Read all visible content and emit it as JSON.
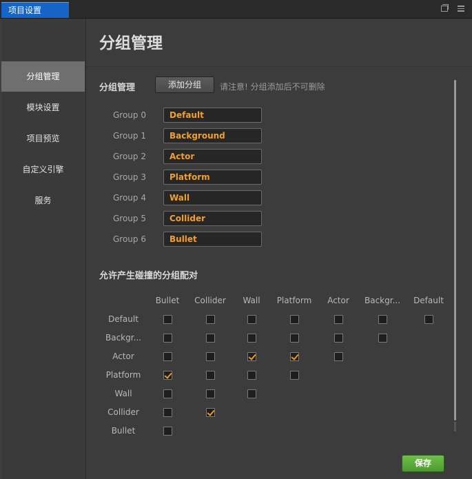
{
  "window": {
    "tab_title": "项目设置"
  },
  "sidebar": {
    "items": [
      {
        "label": "分组管理"
      },
      {
        "label": "模块设置"
      },
      {
        "label": "项目预览"
      },
      {
        "label": "自定义引擎"
      },
      {
        "label": "服务"
      }
    ],
    "active_index": 0
  },
  "main": {
    "title": "分组管理",
    "group_section_label": "分组管理",
    "add_group_button": "添加分组",
    "hint": "请注意! 分组添加后不可删除",
    "groups": [
      {
        "label": "Group 0",
        "name": "Default"
      },
      {
        "label": "Group 1",
        "name": "Background"
      },
      {
        "label": "Group 2",
        "name": "Actor"
      },
      {
        "label": "Group 3",
        "name": "Platform"
      },
      {
        "label": "Group 4",
        "name": "Wall"
      },
      {
        "label": "Group 5",
        "name": "Collider"
      },
      {
        "label": "Group 6",
        "name": "Bullet"
      }
    ],
    "collision_section_label": "允许产生碰撞的分组配对",
    "matrix_columns": [
      "Bullet",
      "Collider",
      "Wall",
      "Platform",
      "Actor",
      "Backgr...",
      "Default"
    ],
    "matrix_rows": [
      {
        "label": "Default",
        "checks": [
          false,
          false,
          false,
          false,
          false,
          false,
          false
        ]
      },
      {
        "label": "Backgr...",
        "checks": [
          false,
          false,
          false,
          false,
          false,
          false
        ]
      },
      {
        "label": "Actor",
        "checks": [
          false,
          false,
          true,
          true,
          false
        ]
      },
      {
        "label": "Platform",
        "checks": [
          true,
          false,
          false,
          false
        ]
      },
      {
        "label": "Wall",
        "checks": [
          false,
          false,
          false
        ]
      },
      {
        "label": "Collider",
        "checks": [
          false,
          true
        ]
      },
      {
        "label": "Bullet",
        "checks": [
          false
        ]
      }
    ],
    "save_button": "保存"
  },
  "colors": {
    "accent_tab": "#1565c8",
    "check_orange": "#f09a20",
    "group_name_orange": "#f0a030",
    "save_green": "#5aaa3a"
  }
}
